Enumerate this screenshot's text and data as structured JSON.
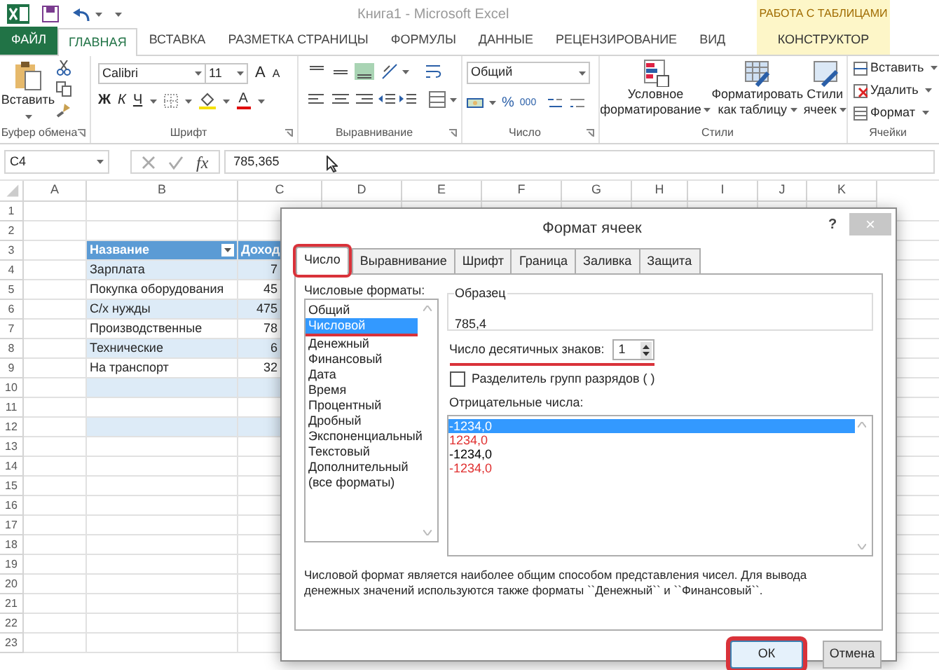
{
  "title_bar": {
    "title": "Книга1 - Microsoft Excel",
    "context_label": "РАБОТА С ТАБЛИЦАМИ"
  },
  "ribbon_tabs": [
    {
      "label": "ФАЙЛ",
      "kind": "file",
      "selected": false
    },
    {
      "label": "ГЛАВНАЯ",
      "kind": "normal",
      "selected": true
    },
    {
      "label": "ВСТАВКА",
      "kind": "normal",
      "selected": false
    },
    {
      "label": "РАЗМЕТКА СТРАНИЦЫ",
      "kind": "normal",
      "selected": false
    },
    {
      "label": "ФОРМУЛЫ",
      "kind": "normal",
      "selected": false
    },
    {
      "label": "ДАННЫЕ",
      "kind": "normal",
      "selected": false
    },
    {
      "label": "РЕЦЕНЗИРОВАНИЕ",
      "kind": "normal",
      "selected": false
    },
    {
      "label": "ВИД",
      "kind": "normal",
      "selected": false
    },
    {
      "label": "КОНСТРУКТОР",
      "kind": "context",
      "selected": false
    }
  ],
  "clipboard": {
    "paste": "Вставить",
    "group": "Буфер обмена"
  },
  "font": {
    "family": "Calibri",
    "size": "11",
    "grow": "A",
    "shrink": "A",
    "bold": "Ж",
    "italic": "К",
    "underline": "Ч",
    "color_letter": "А",
    "group": "Шрифт"
  },
  "alignment": {
    "group": "Выравнивание"
  },
  "number": {
    "format": "Общий",
    "percent": "%",
    "thousands": "000",
    "group": "Число"
  },
  "styles": {
    "buttons": [
      {
        "lines": [
          "Условное",
          "форматирование"
        ]
      },
      {
        "lines": [
          "Форматировать",
          "как таблицу"
        ]
      },
      {
        "lines": [
          "Стили",
          "ячеек"
        ]
      }
    ],
    "group": "Стили"
  },
  "cells": {
    "buttons": [
      "Вставить",
      "Удалить",
      "Формат"
    ],
    "group": "Ячейки"
  },
  "formula_bar": {
    "name_box": "C4",
    "fx": "fx",
    "value": "785,365"
  },
  "sheet": {
    "columns": [
      "A",
      "B",
      "C",
      "D",
      "E",
      "F",
      "G",
      "H",
      "I",
      "J",
      "K"
    ],
    "rows": [
      "1",
      "2",
      "3",
      "4",
      "5",
      "6",
      "7",
      "8",
      "9",
      "10",
      "11",
      "12",
      "13",
      "14",
      "15",
      "16",
      "17",
      "18",
      "19",
      "20",
      "21",
      "22",
      "23"
    ],
    "table": {
      "header": [
        "Название",
        "Доход"
      ],
      "rows": [
        {
          "kind": "data",
          "cells": [
            "Зарплата",
            "7"
          ]
        },
        {
          "kind": "data",
          "cells": [
            "Покупка оборудования",
            "45"
          ]
        },
        {
          "kind": "data",
          "cells": [
            "С/х нужды",
            "475"
          ]
        },
        {
          "kind": "data",
          "cells": [
            "Производственные",
            "78"
          ]
        },
        {
          "kind": "data",
          "cells": [
            "Технические",
            "6"
          ]
        },
        {
          "kind": "data",
          "cells": [
            "На транспорт",
            "32"
          ]
        },
        {
          "kind": "blank"
        },
        {
          "kind": "blank"
        },
        {
          "kind": "blank"
        }
      ]
    }
  },
  "dialog": {
    "title": "Формат ячеек",
    "help": "?",
    "close": "×",
    "tabs": [
      {
        "label": "Число",
        "selected": true,
        "annotated": true
      },
      {
        "label": "Выравнивание",
        "selected": false,
        "annotated": false
      },
      {
        "label": "Шрифт",
        "selected": false,
        "annotated": false
      },
      {
        "label": "Граница",
        "selected": false,
        "annotated": false
      },
      {
        "label": "Заливка",
        "selected": false,
        "annotated": false
      },
      {
        "label": "Защита",
        "selected": false,
        "annotated": false
      }
    ],
    "formats_label": "Числовые форматы:",
    "formats": [
      {
        "label": "Общий",
        "selected": false,
        "annotated": false
      },
      {
        "label": "Числовой",
        "selected": true,
        "annotated": true
      },
      {
        "label": "Денежный",
        "selected": false,
        "annotated": false
      },
      {
        "label": "Финансовый",
        "selected": false,
        "annotated": false
      },
      {
        "label": "Дата",
        "selected": false,
        "annotated": false
      },
      {
        "label": "Время",
        "selected": false,
        "annotated": false
      },
      {
        "label": "Процентный",
        "selected": false,
        "annotated": false
      },
      {
        "label": "Дробный",
        "selected": false,
        "annotated": false
      },
      {
        "label": "Экспоненциальный",
        "selected": false,
        "annotated": false
      },
      {
        "label": "Текстовый",
        "selected": false,
        "annotated": false
      },
      {
        "label": "Дополнительный",
        "selected": false,
        "annotated": false
      },
      {
        "label": "(все форматы)",
        "selected": false,
        "annotated": false
      }
    ],
    "sample_label": "Образец",
    "sample_value": "785,4",
    "decimals": {
      "label": "Число десятичных знаков:",
      "value": "1",
      "annotated": true
    },
    "separator": {
      "label": "Разделитель групп разрядов ( )",
      "checked": false
    },
    "negatives_label": "Отрицательные числа:",
    "negatives": [
      {
        "text": "-1234,0",
        "selected": true
      },
      {
        "text": "1234,0",
        "color": "#e03030",
        "selected": false
      },
      {
        "text": "-1234,0",
        "color": "#000000",
        "selected": false
      },
      {
        "text": "-1234,0",
        "color": "#e03030",
        "selected": false
      }
    ],
    "description": "Числовой формат является наиболее общим способом представления чисел. Для вывода денежных значений используются также форматы ``Денежный`` и ``Финансовый``.",
    "buttons": [
      {
        "label": "ОК",
        "annotated": true
      },
      {
        "label": "Отмена",
        "annotated": false
      }
    ]
  }
}
